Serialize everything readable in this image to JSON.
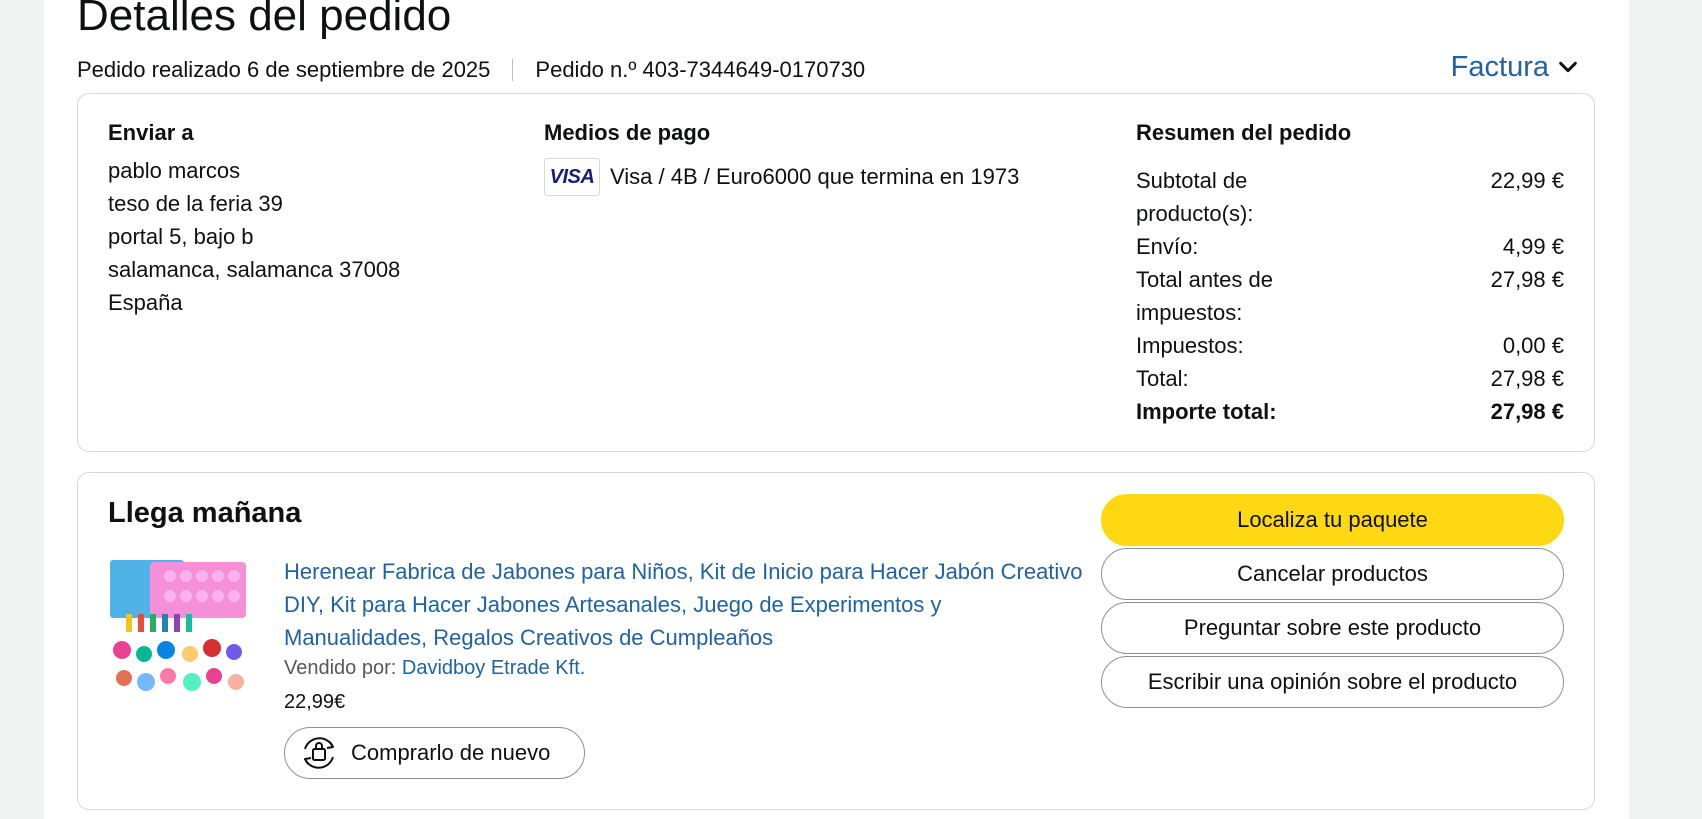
{
  "header": {
    "title": "Detalles del pedido",
    "placed": "Pedido realizado 6 de septiembre de 2025",
    "order_number": "Pedido n.º 403-7344649-0170730",
    "invoice_label": "Factura"
  },
  "shipping": {
    "heading": "Enviar a",
    "lines": [
      "pablo marcos",
      "teso de la feria 39",
      "portal 5, bajo b",
      "salamanca, salamanca 37008",
      "España"
    ]
  },
  "payment": {
    "heading": "Medios de pago",
    "card_brand": "VISA",
    "description": "Visa / 4B / Euro6000 que termina en 1973"
  },
  "summary": {
    "heading": "Resumen del pedido",
    "rows": [
      {
        "label": "Subtotal de producto(s):",
        "value": "22,99 €"
      },
      {
        "label": "Envío:",
        "value": "4,99 €"
      },
      {
        "label": "Total antes de impuestos:",
        "value": "27,98 €"
      },
      {
        "label": "Impuestos:",
        "value": "0,00 €"
      },
      {
        "label": "Total:",
        "value": "27,98 €"
      }
    ],
    "grand_total_label": "Importe total:",
    "grand_total_value": "27,98 €"
  },
  "shipment": {
    "status": "Llega mañana",
    "product_title": "Herenear Fabrica de Jabones para Niños, Kit de Inicio para Hacer Jabón Creativo DIY, Kit para Hacer Jabones Artesanales, Juego de Experimentos y Manualidades, Regalos Creativos de Cumpleaños",
    "seller_label": "Vendido por:",
    "seller_name": "Davidboy Etrade Kft.",
    "price": "22,99€",
    "buy_again_label": "Comprarlo de nuevo",
    "buy_again_icon": "buy-again-icon"
  },
  "actions": {
    "track": "Localiza tu paquete",
    "cancel": "Cancelar productos",
    "ask": "Preguntar sobre este producto",
    "review": "Escribir una opinión sobre el producto"
  },
  "colors": {
    "link": "#2162a1",
    "primary_button": "#ffd814",
    "border": "#d5d9d9",
    "page_bg": "#f0f2f2"
  }
}
